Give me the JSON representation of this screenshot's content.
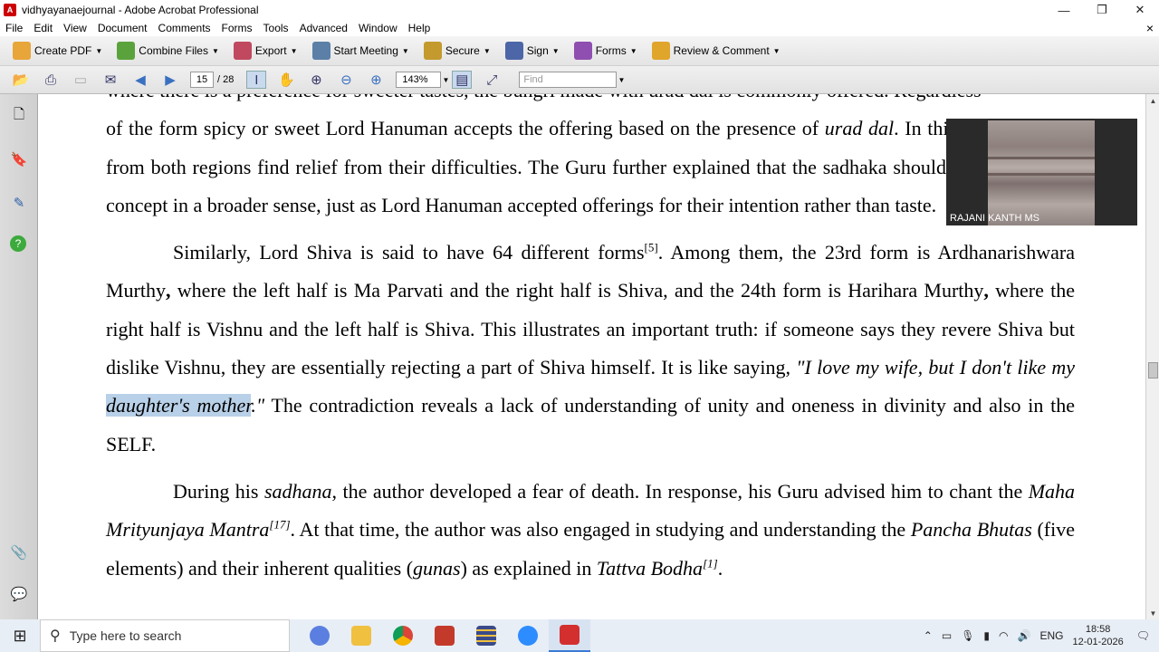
{
  "window": {
    "title": "vidhyayanaejournal - Adobe Acrobat Professional",
    "minimize": "—",
    "restore": "❐",
    "close": "✕"
  },
  "menu": [
    "File",
    "Edit",
    "View",
    "Document",
    "Comments",
    "Forms",
    "Tools",
    "Advanced",
    "Window",
    "Help"
  ],
  "menu_close": "×",
  "toolbar1": [
    {
      "label": "Create PDF",
      "color": "#e8a53a"
    },
    {
      "label": "Combine Files",
      "color": "#5aa33c"
    },
    {
      "label": "Export",
      "color": "#c0495f"
    },
    {
      "label": "Start Meeting",
      "color": "#5c7fa8"
    },
    {
      "label": "Secure",
      "color": "#c49a2e"
    },
    {
      "label": "Sign",
      "color": "#4d66a8"
    },
    {
      "label": "Forms",
      "color": "#8f4fb0"
    },
    {
      "label": "Review & Comment",
      "color": "#e0a52b"
    }
  ],
  "nav": {
    "page": "15",
    "total": "/ 28",
    "zoom": "143%",
    "find_placeholder": "Find"
  },
  "document": {
    "line0": "where there is a preference for sweeter tastes, the bungri made with urad dal is commonly offered. Regardless",
    "p1": "of the form spicy or sweet Lord Hanuman accepts the offering based on the presence of urad dal. In this way, devotees from both regions find relief from their difficulties. The Guru further explained that the sadhaka should understand this concept in a broader sense, just as Lord Hanuman accepted offerings for their intention rather than taste.",
    "p1_a": "of the form spicy or sweet Lord Hanuman accepts the offering based on the presence of ",
    "p1_i": "urad dal",
    "p1_b": ". In this way, devotees from both regions find relief from their difficulties. The Guru further explained that the sadhaka should understand this concept in a broader sense, just as Lord Hanuman accepted offerings for their intention rather than taste.",
    "p2_a": "Similarly, Lord Shiva is said to have 64 different forms",
    "p2_sup": "[5]",
    "p2_b": ". Among them, the 23rd form is Ardhanarishwara Murthy",
    "p2_bold1": ",",
    "p2_c": " where the left half is Ma Parvati and the right half is Shiva, and the 24th form is Harihara Murthy",
    "p2_bold2": ",",
    "p2_d": " where the right half is Vishnu and the left half is Shiva. This illustrates an important truth: if someone says they revere Shiva but dislike Vishnu, they are essentially rejecting a part of Shiva himself. It is like saying, ",
    "p2_quote_a": "\"I love my wife, but I don't like my ",
    "p2_highlight": "daughter's mother",
    "p2_quote_b": ".\"",
    "p2_e": " The contradiction reveals a lack of understanding of unity and oneness in divinity and also in the SELF.",
    "p3_a": "During his ",
    "p3_i1": "sadhana",
    "p3_b": ", the author developed a fear of death. In response, his Guru advised him to chant the ",
    "p3_i2": "Maha Mrityunjaya Mantra",
    "p3_sup1": "[17]",
    "p3_c": ". At that time, the author was also engaged in studying and understanding the ",
    "p3_i3": "Pancha Bhutas",
    "p3_d": " (five elements) and their inherent qualities (",
    "p3_i4": "gunas",
    "p3_e": ") as explained in ",
    "p3_i5": "Tattva Bodha",
    "p3_sup2": "[1]",
    "p3_f": "."
  },
  "video": {
    "participant": "RAJANI KANTH MS"
  },
  "taskbar": {
    "search_placeholder": "Type here to search",
    "lang": "ENG",
    "time": "18:58",
    "date": "12-01-2026",
    "apps": [
      {
        "name": "copilot",
        "color": "#5b7fe0"
      },
      {
        "name": "file-explorer",
        "color": "#f0c040"
      },
      {
        "name": "chrome",
        "color": "#db4437"
      },
      {
        "name": "app-red",
        "color": "#c33a2a"
      },
      {
        "name": "app-stripe",
        "color": "#3a4a8a"
      },
      {
        "name": "zoom",
        "color": "#2d8cff"
      },
      {
        "name": "acrobat",
        "color": "#d32f2f"
      }
    ]
  }
}
